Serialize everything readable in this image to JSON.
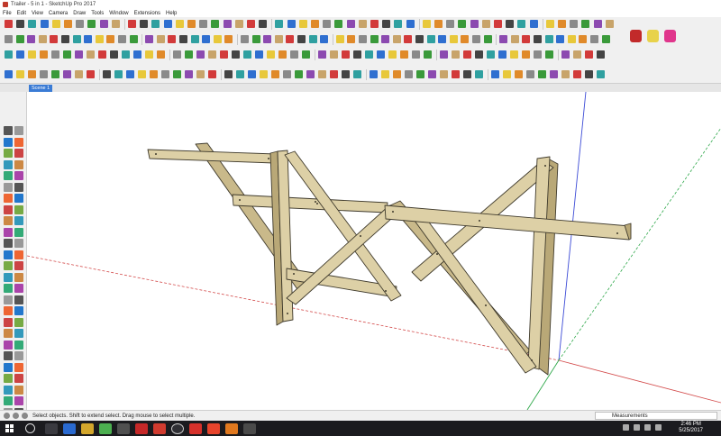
{
  "window": {
    "title": "Trailer - 5 in 1 - SketchUp Pro 2017"
  },
  "menu": [
    "File",
    "Edit",
    "View",
    "Camera",
    "Draw",
    "Tools",
    "Window",
    "Extensions",
    "Help"
  ],
  "scene_tab": "Scene 1",
  "statusbar": {
    "message": "Select objects. Shift to extend select. Drag mouse to select multiple.",
    "measurements_label": "Measurements"
  },
  "taskbar": {
    "time": "2:46 PM",
    "date": "5/25/2017"
  },
  "colors": {
    "wood_face": "#ddd0a6",
    "wood_side": "#b9a877",
    "wood_edge": "#3f3a2c",
    "axis_red": "#d34a4a",
    "axis_green": "#2ea84a",
    "axis_blue": "#3b4ad6",
    "selected_tab": "#3a7bd5"
  }
}
